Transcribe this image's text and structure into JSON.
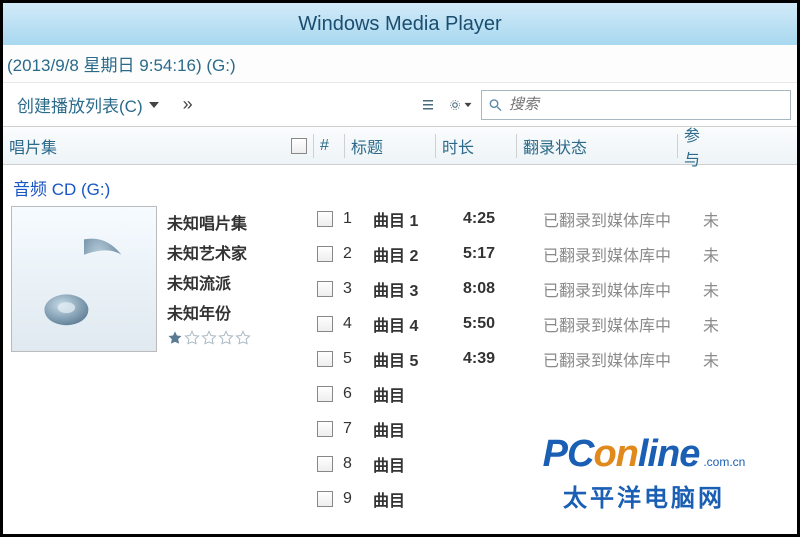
{
  "window": {
    "title": "Windows Media Player"
  },
  "breadcrumb": {
    "text": "(2013/9/8 星期日 9:54:16) (G:)"
  },
  "toolbar": {
    "playlist_btn": "创建播放列表(C)",
    "more": "»"
  },
  "search": {
    "placeholder": "搜索"
  },
  "columns": {
    "album": "唱片集",
    "num": "#",
    "title": "标题",
    "duration": "时长",
    "status": "翻录状态",
    "participant": "参与"
  },
  "album": {
    "source": "音频 CD (G:)",
    "meta": {
      "album_name": "未知唱片集",
      "artist": "未知艺术家",
      "genre": "未知流派",
      "year": "未知年份"
    },
    "rating_filled": 1,
    "rating_total": 5
  },
  "tracks": [
    {
      "num": "1",
      "title": "曲目 1",
      "duration": "4:25",
      "status": "已翻录到媒体库中",
      "participant": "未"
    },
    {
      "num": "2",
      "title": "曲目 2",
      "duration": "5:17",
      "status": "已翻录到媒体库中",
      "participant": "未"
    },
    {
      "num": "3",
      "title": "曲目 3",
      "duration": "8:08",
      "status": "已翻录到媒体库中",
      "participant": "未"
    },
    {
      "num": "4",
      "title": "曲目 4",
      "duration": "5:50",
      "status": "已翻录到媒体库中",
      "participant": "未"
    },
    {
      "num": "5",
      "title": "曲目 5",
      "duration": "4:39",
      "status": "已翻录到媒体库中",
      "participant": "未"
    },
    {
      "num": "6",
      "title": "曲目",
      "duration": "",
      "status": "",
      "participant": ""
    },
    {
      "num": "7",
      "title": "曲目",
      "duration": "",
      "status": "",
      "participant": ""
    },
    {
      "num": "8",
      "title": "曲目",
      "duration": "",
      "status": "",
      "participant": ""
    },
    {
      "num": "9",
      "title": "曲目",
      "duration": "",
      "status": "",
      "participant": ""
    }
  ],
  "watermark": {
    "brand_head": "PC",
    "brand_mid": "on",
    "brand_tail": "line",
    "suffix": ".com.cn",
    "cn": "太平洋电脑网"
  }
}
